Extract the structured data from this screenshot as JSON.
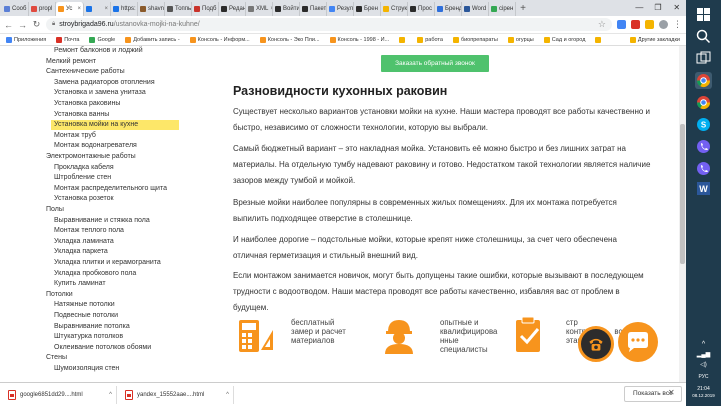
{
  "browser": {
    "tabs": [
      {
        "label": "Сооб",
        "color": "#5b7fd6"
      },
      {
        "label": "propl",
        "color": "#e04a3f"
      },
      {
        "label": "Ус",
        "color": "#f7941d",
        "active": true
      },
      {
        "label": "",
        "color": "#1a73e8"
      },
      {
        "label": "https:",
        "color": "#1a73e8"
      },
      {
        "label": "shavn",
        "color": "#8a5a2b"
      },
      {
        "label": "Топпь",
        "color": "#555555"
      },
      {
        "label": "Подб",
        "color": "#c9332b"
      },
      {
        "label": "Редан",
        "color": "#2b2b2b"
      },
      {
        "label": "XML",
        "color": "#777777"
      },
      {
        "label": "Войти",
        "color": "#2b2b2b"
      },
      {
        "label": "Пакет",
        "color": "#2b2b2b"
      },
      {
        "label": "Резул",
        "color": "#4285f4"
      },
      {
        "label": "Брен",
        "color": "#2b2b2b"
      },
      {
        "label": "Струк",
        "color": "#f4b400"
      },
      {
        "label": "Прос",
        "color": "#2b2b2b"
      },
      {
        "label": "Бренд",
        "color": "#2f6fdb"
      },
      {
        "label": "Word",
        "color": "#2b579a"
      },
      {
        "label": "сірен",
        "color": "#34a853"
      }
    ],
    "new_tab": "+",
    "window_controls": [
      "—",
      "❐",
      "✕"
    ],
    "address": {
      "host": "stroybrigada96.ru",
      "path": "/ustanovka-mojki-na-kuhne/"
    },
    "bookmarks": [
      {
        "label": "Приложения",
        "color": "#4285f4"
      },
      {
        "label": "Почта",
        "color": "#d93025"
      },
      {
        "label": "Google",
        "color": "#34a853"
      },
      {
        "label": "Добавить запись -",
        "color": "#f7941d"
      },
      {
        "label": "Консоль - Информ...",
        "color": "#f7941d"
      },
      {
        "label": "Консоль - Эко Пли...",
        "color": "#f7941d"
      },
      {
        "label": "Консоль - 1998 - И...",
        "color": "#f7941d"
      },
      {
        "label": "",
        "color": "#f4b400"
      },
      {
        "label": "работа",
        "color": "#f4b400"
      },
      {
        "label": "биопрепараты",
        "color": "#f4b400"
      },
      {
        "label": "огурцы",
        "color": "#f4b400"
      },
      {
        "label": "Сад и огород",
        "color": "#f4b400"
      },
      {
        "label": "",
        "color": "#f4b400"
      }
    ],
    "other_bookmarks": "Другие закладки"
  },
  "sidebar": {
    "items": [
      {
        "label": "Ремонт балконов и лоджий",
        "level": 2
      },
      {
        "label": "Мелкий ремонт",
        "level": 1
      },
      {
        "label": "Сантехнические работы",
        "level": 1
      },
      {
        "label": "Замена радиаторов отопления",
        "level": 2
      },
      {
        "label": "Установка и замена унитаза",
        "level": 2
      },
      {
        "label": "Установка раковины",
        "level": 2
      },
      {
        "label": "Установка ванны",
        "level": 2
      },
      {
        "label": "Установка мойки на кухне",
        "level": 2,
        "active": true
      },
      {
        "label": "Монтаж труб",
        "level": 2
      },
      {
        "label": "Монтаж водонагревателя",
        "level": 2
      },
      {
        "label": "Электромонтажные работы",
        "level": 1
      },
      {
        "label": "Прокладка кабеля",
        "level": 2
      },
      {
        "label": "Штробление стен",
        "level": 2
      },
      {
        "label": "Монтаж распределительного щита",
        "level": 2
      },
      {
        "label": "Установка розеток",
        "level": 2
      },
      {
        "label": "Полы",
        "level": 1
      },
      {
        "label": "Выравнивание и стяжка пола",
        "level": 2
      },
      {
        "label": "Монтаж теплого пола",
        "level": 2
      },
      {
        "label": "Укладка ламината",
        "level": 2
      },
      {
        "label": "Укладка паркета",
        "level": 2
      },
      {
        "label": "Укладка плитки и керамогранита",
        "level": 2
      },
      {
        "label": "Укладка пробкового пола",
        "level": 2
      },
      {
        "label": "Купить ламинат",
        "level": 2
      },
      {
        "label": "Потолки",
        "level": 1
      },
      {
        "label": "Натяжные потолки",
        "level": 2
      },
      {
        "label": "Подвесные потолки",
        "level": 2
      },
      {
        "label": "Выравнивание потолка",
        "level": 2
      },
      {
        "label": "Штукатурка потолков",
        "level": 2
      },
      {
        "label": "Оклеивание потолков обоями",
        "level": 2
      },
      {
        "label": "Стены",
        "level": 1
      },
      {
        "label": "Шумоизоляция стен",
        "level": 2
      }
    ]
  },
  "main": {
    "cta_label": "Заказать обратный звонок",
    "heading": "Разновидности кухонных раковин",
    "paragraphs": [
      "Существует несколько вариантов установки мойки на кухне. Наши мастера проводят все работы качественно и быстро, независимо от сложности технологии, которую вы выбрали.",
      "Самый бюджетный вариант – это накладная мойка. Установить её можно быстро и без лишних затрат на материалы. На отдельную тумбу надевают раковину и готово. Недостатком такой технологии является наличие зазоров между тумбой и мойкой.",
      "Врезные мойки наиболее популярны в современных жилых помещениях. Для их монтажа потребуется выпилить подходящее отверстие в столешнице.",
      "И наиболее дорогие – подстольные мойки, которые крепят ниже столешницы, за счет чего обеспечена отличная герметизация и стильный внешний вид.",
      "Если монтажом занимается новичок, могут быть допущены такие ошибки, которые вызывают в последующем трудности с водоотводом.  Наши мастера проводят все работы качественно, избавляя вас от проблем в будущем."
    ],
    "features": [
      {
        "lines": [
          "бесплатный",
          "замер и расчет",
          "материалов"
        ]
      },
      {
        "lines": [
          "опытные и",
          "квалифицирова",
          "нные",
          "специалисты"
        ]
      },
      {
        "lines": [
          "стр",
          "контро",
          "этапов работ"
        ]
      }
    ],
    "feature_tail": "всех",
    "accent_color": "#f7941d",
    "cta_color": "#4fc26d"
  },
  "downloads": {
    "items": [
      "google6851dd29....html",
      "yandex_15552aae....html"
    ],
    "show_all": "Показать все",
    "close": "✕"
  },
  "taskbar": {
    "lang": "РУС",
    "time": "21:04",
    "date": "08.12.2019"
  }
}
